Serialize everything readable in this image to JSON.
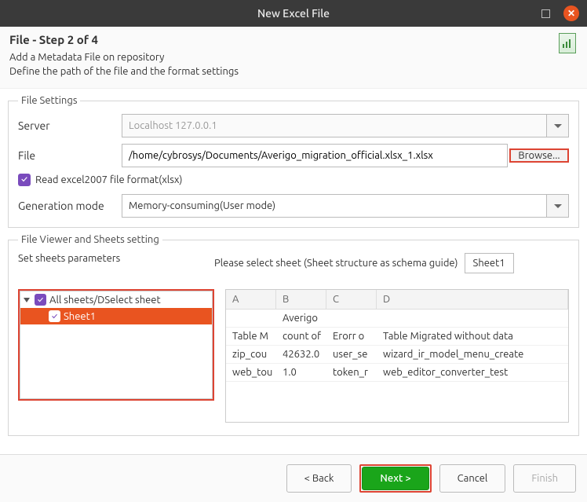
{
  "window": {
    "title": "New Excel File"
  },
  "header": {
    "title": "File - Step 2 of 4",
    "line1": "Add a Metadata File on repository",
    "line2": "Define the path of the file and the format settings"
  },
  "fileSettings": {
    "legend": "File Settings",
    "serverLabel": "Server",
    "serverValue": "Localhost 127.0.0.1",
    "fileLabel": "File",
    "fileValue": "/home/cybrosys/Documents/Averigo_migration_official.xlsx_1.xlsx",
    "browseLabel": "Browse...",
    "readXlsxLabel": "Read excel2007 file format(xlsx)",
    "genModeLabel": "Generation mode",
    "genModeValue": "Memory-consuming(User mode)"
  },
  "viewer": {
    "legend": "File Viewer and Sheets setting",
    "paramsLabel": "Set sheets parameters",
    "selectSheetLabel": "Please select sheet (Sheet structure as schema guide)",
    "selectedSheet": "Sheet1",
    "treeRoot": "All sheets/DSelect sheet",
    "treeChild": "Sheet1",
    "columns": {
      "a": "A",
      "b": "B",
      "c": "C",
      "d": "D"
    },
    "rows": [
      {
        "a": "",
        "b": "Averigo",
        "c": "",
        "d": ""
      },
      {
        "a": "Table M",
        "b": "count of",
        "c": "Erorr o",
        "d": "Table Migrated without data"
      },
      {
        "a": "zip_cou",
        "b": "42632.0",
        "c": "user_se",
        "d": "wizard_ir_model_menu_create"
      },
      {
        "a": "web_tou",
        "b": "1.0",
        "c": "token_r",
        "d": "web_editor_converter_test"
      }
    ]
  },
  "footer": {
    "back": "< Back",
    "next": "Next >",
    "cancel": "Cancel",
    "finish": "Finish"
  }
}
